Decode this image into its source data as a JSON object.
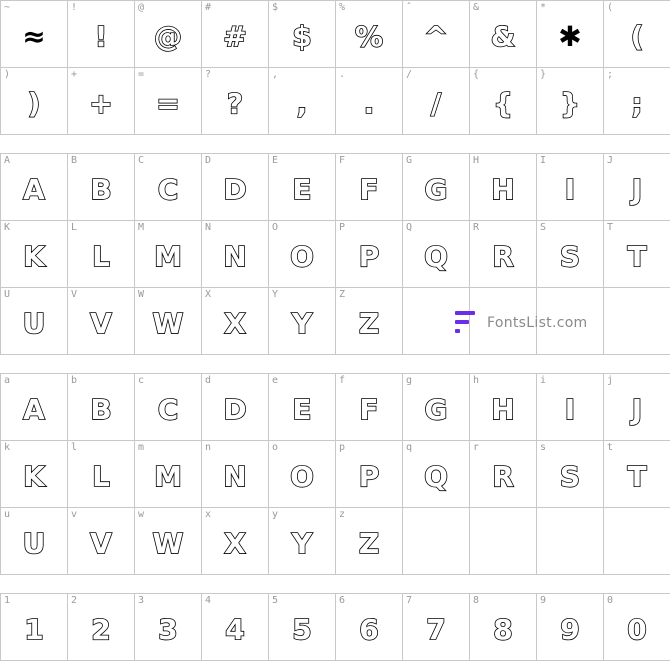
{
  "symbols": [
    {
      "key": "~",
      "glyph": "≈"
    },
    {
      "key": "!",
      "glyph": "!"
    },
    {
      "key": "@",
      "glyph": "@"
    },
    {
      "key": "#",
      "glyph": "#"
    },
    {
      "key": "$",
      "glyph": "$"
    },
    {
      "key": "%",
      "glyph": "%"
    },
    {
      "key": "ˆ",
      "glyph": "^"
    },
    {
      "key": "&",
      "glyph": "&"
    },
    {
      "key": "*",
      "glyph": "✱"
    },
    {
      "key": "(",
      "glyph": "("
    },
    {
      "key": ")",
      "glyph": ")"
    },
    {
      "key": "+",
      "glyph": "+"
    },
    {
      "key": "=",
      "glyph": "="
    },
    {
      "key": "?",
      "glyph": "?"
    },
    {
      "key": ",",
      "glyph": ","
    },
    {
      "key": ".",
      "glyph": "."
    },
    {
      "key": "/",
      "glyph": "/"
    },
    {
      "key": "{",
      "glyph": "{"
    },
    {
      "key": "}",
      "glyph": "}"
    },
    {
      "key": ";",
      "glyph": ";"
    }
  ],
  "uppercase": [
    {
      "key": "A",
      "glyph": "A"
    },
    {
      "key": "B",
      "glyph": "B"
    },
    {
      "key": "C",
      "glyph": "C"
    },
    {
      "key": "D",
      "glyph": "D"
    },
    {
      "key": "E",
      "glyph": "E"
    },
    {
      "key": "F",
      "glyph": "F"
    },
    {
      "key": "G",
      "glyph": "G"
    },
    {
      "key": "H",
      "glyph": "H"
    },
    {
      "key": "I",
      "glyph": "I"
    },
    {
      "key": "J",
      "glyph": "J"
    },
    {
      "key": "K",
      "glyph": "K"
    },
    {
      "key": "L",
      "glyph": "L"
    },
    {
      "key": "M",
      "glyph": "M"
    },
    {
      "key": "N",
      "glyph": "N"
    },
    {
      "key": "O",
      "glyph": "O"
    },
    {
      "key": "P",
      "glyph": "P"
    },
    {
      "key": "Q",
      "glyph": "Q"
    },
    {
      "key": "R",
      "glyph": "R"
    },
    {
      "key": "S",
      "glyph": "S"
    },
    {
      "key": "T",
      "glyph": "T"
    },
    {
      "key": "U",
      "glyph": "U"
    },
    {
      "key": "V",
      "glyph": "V"
    },
    {
      "key": "W",
      "glyph": "W"
    },
    {
      "key": "X",
      "glyph": "X"
    },
    {
      "key": "Y",
      "glyph": "Y"
    },
    {
      "key": "Z",
      "glyph": "Z"
    }
  ],
  "lowercase": [
    {
      "key": "a",
      "glyph": "A"
    },
    {
      "key": "b",
      "glyph": "B"
    },
    {
      "key": "c",
      "glyph": "C"
    },
    {
      "key": "d",
      "glyph": "D"
    },
    {
      "key": "e",
      "glyph": "E"
    },
    {
      "key": "f",
      "glyph": "F"
    },
    {
      "key": "g",
      "glyph": "G"
    },
    {
      "key": "h",
      "glyph": "H"
    },
    {
      "key": "i",
      "glyph": "I"
    },
    {
      "key": "j",
      "glyph": "J"
    },
    {
      "key": "k",
      "glyph": "K"
    },
    {
      "key": "l",
      "glyph": "L"
    },
    {
      "key": "m",
      "glyph": "M"
    },
    {
      "key": "n",
      "glyph": "N"
    },
    {
      "key": "o",
      "glyph": "O"
    },
    {
      "key": "p",
      "glyph": "P"
    },
    {
      "key": "q",
      "glyph": "Q"
    },
    {
      "key": "r",
      "glyph": "R"
    },
    {
      "key": "s",
      "glyph": "S"
    },
    {
      "key": "t",
      "glyph": "T"
    },
    {
      "key": "u",
      "glyph": "U"
    },
    {
      "key": "v",
      "glyph": "V"
    },
    {
      "key": "w",
      "glyph": "W"
    },
    {
      "key": "x",
      "glyph": "X"
    },
    {
      "key": "y",
      "glyph": "Y"
    },
    {
      "key": "z",
      "glyph": "Z"
    }
  ],
  "digits": [
    {
      "key": "1",
      "glyph": "1"
    },
    {
      "key": "2",
      "glyph": "2"
    },
    {
      "key": "3",
      "glyph": "3"
    },
    {
      "key": "4",
      "glyph": "4"
    },
    {
      "key": "5",
      "glyph": "5"
    },
    {
      "key": "6",
      "glyph": "6"
    },
    {
      "key": "7",
      "glyph": "7"
    },
    {
      "key": "8",
      "glyph": "8"
    },
    {
      "key": "9",
      "glyph": "9"
    },
    {
      "key": "0",
      "glyph": "0"
    }
  ],
  "watermark": {
    "text": "FontsList.com",
    "icon": "fontslist-logo-icon",
    "color": "#6a2ee8"
  }
}
